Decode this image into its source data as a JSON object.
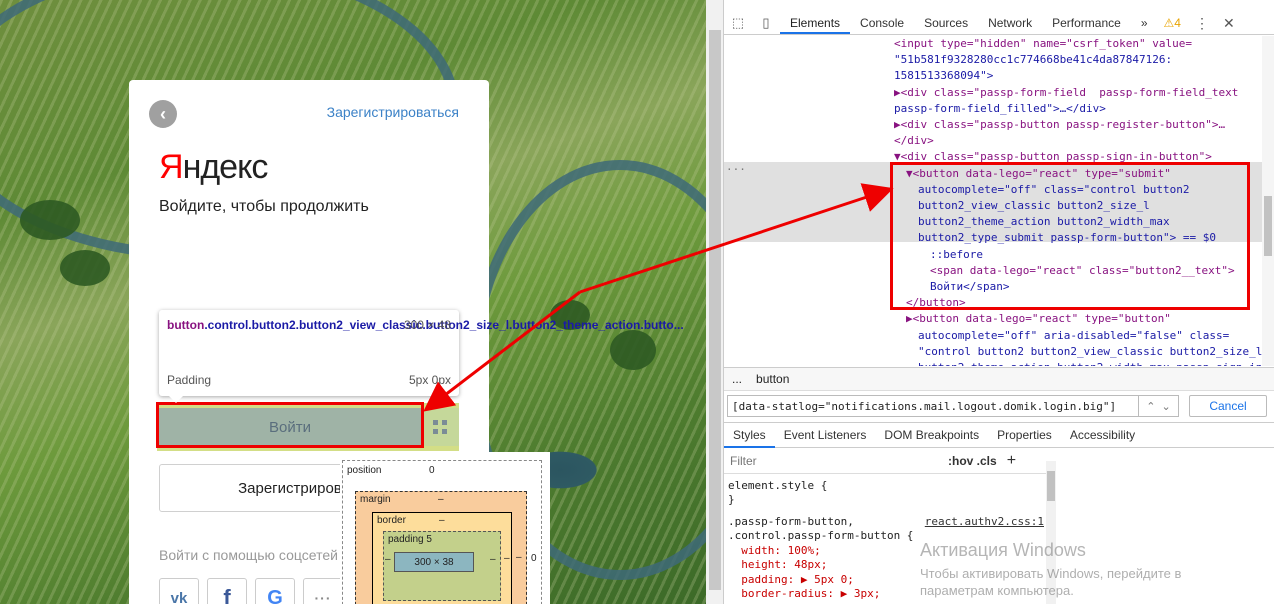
{
  "login": {
    "register_link": "Зарегистрироваться",
    "logo_first": "Я",
    "logo_rest": "ндекс",
    "subtitle": "Войдите, чтобы продолжить",
    "signin_label": "Войти",
    "register_button": "Зарегистрироваться",
    "social_label": "Войти с помощью соцсетей",
    "social": [
      {
        "label": "vk",
        "icon": "vk-icon"
      },
      {
        "label": "f",
        "icon": "facebook-icon"
      },
      {
        "label": "G",
        "icon": "google-icon"
      },
      {
        "label": "···",
        "icon": "more-icon"
      }
    ]
  },
  "tooltip": {
    "tag": "button",
    "classes": ".control.button2.button2_view_classic.button2_size_l.button2_theme_action.butto...",
    "size": "300 × 48",
    "padding_label": "Padding",
    "padding_value": "5px 0px"
  },
  "devtools": {
    "tabs": [
      "Elements",
      "Console",
      "Sources",
      "Network",
      "Performance"
    ],
    "active_tab": "Elements",
    "more": "»",
    "warnings": "4",
    "dom_lines": [
      {
        "indent": 0,
        "text": "<input type=\"hidden\" name=\"csrf_token\" value="
      },
      {
        "indent": 0,
        "text": "\"51b581f9328280cc1c774668be41c4da87847126:"
      },
      {
        "indent": 0,
        "text": "1581513368094\">"
      },
      {
        "indent": 0,
        "text": "▶<div class=\"passp-form-field  passp-form-field_text"
      },
      {
        "indent": 0,
        "text": "passp-form-field_filled\">…</div>"
      },
      {
        "indent": 0,
        "text": "▶<div class=\"passp-button passp-register-button\">…"
      },
      {
        "indent": 0,
        "text": "</div>"
      },
      {
        "indent": 0,
        "text": "▼<div class=\"passp-button passp-sign-in-button\">"
      },
      {
        "indent": 1,
        "text": "▼<button data-lego=\"react\" type=\"submit\""
      },
      {
        "indent": 2,
        "text": "autocomplete=\"off\" class=\"control button2"
      },
      {
        "indent": 2,
        "text": "button2_view_classic button2_size_l"
      },
      {
        "indent": 2,
        "text": "button2_theme_action button2_width_max"
      },
      {
        "indent": 2,
        "text": "button2_type_submit passp-form-button\"> == $0"
      },
      {
        "indent": 3,
        "text": "::before"
      },
      {
        "indent": 3,
        "text": "<span data-lego=\"react\" class=\"button2__text\">"
      },
      {
        "indent": 3,
        "text": "Войти</span>"
      },
      {
        "indent": 1,
        "text": "</button>"
      },
      {
        "indent": 1,
        "text": "▶<button data-lego=\"react\" type=\"button\""
      },
      {
        "indent": 2,
        "text": "autocomplete=\"off\" aria-disabled=\"false\" class="
      },
      {
        "indent": 2,
        "text": "\"control button2 button2_view_classic button2_size_l"
      },
      {
        "indent": 2,
        "text": "button2_theme_action button2_width_max passp-sign-in"
      }
    ],
    "breadcrumb_dots": "...",
    "breadcrumb_item": "button",
    "search_value": "[data-statlog=\"notifications.mail.logout.domik.login.big\"]",
    "cancel_label": "Cancel",
    "sub_tabs": [
      "Styles",
      "Event Listeners",
      "DOM Breakpoints",
      "Properties",
      "Accessibility"
    ],
    "filter_placeholder": "Filter",
    "hov_cls": ":hov  .cls",
    "styles_lines": [
      "element.style {",
      "}",
      ".passp-form-button,",
      ".control.passp-form-button {",
      "  width: 100%;",
      "  height: 48px;",
      "  padding: ▶ 5px 0;",
      "  border-radius: ▶ 3px;"
    ],
    "styles_source": "react.authv2.css:1",
    "box_model": {
      "position_label": "position",
      "position_value": "0",
      "margin_label": "margin",
      "margin_value": "–",
      "border_label": "border",
      "border_value": "–",
      "padding_label": "padding 5",
      "content": "300 × 38",
      "side_value": "–",
      "zero": "0"
    }
  },
  "watermark": {
    "title": "Активация Windows",
    "subtitle_1": "Чтобы активировать Windows, перейдите в",
    "subtitle_2": "параметрам компьютера."
  }
}
